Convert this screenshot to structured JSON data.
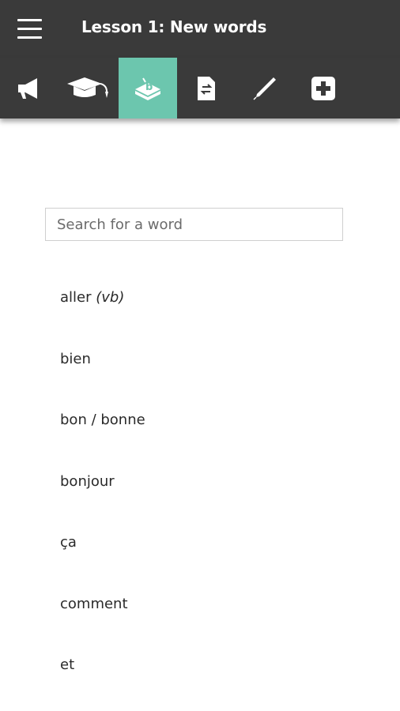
{
  "header": {
    "menu_icon": "hamburger-menu-icon",
    "title": "Lesson 1: New words"
  },
  "toolbar": {
    "accent_color": "#6cc6ae",
    "background_color": "#3a3a3a",
    "active_tab": "vocabulary",
    "tabs": [
      {
        "id": "audio",
        "icon": "megaphone-icon"
      },
      {
        "id": "learn",
        "icon": "graduation-cap-icon"
      },
      {
        "id": "vocabulary",
        "icon": "word-box-icon"
      },
      {
        "id": "translate",
        "icon": "document-swap-icon"
      },
      {
        "id": "write",
        "icon": "pen-icon"
      },
      {
        "id": "more",
        "icon": "plus-square-icon"
      }
    ]
  },
  "search": {
    "placeholder": "Search for a word",
    "value": ""
  },
  "words": [
    {
      "word": "aller",
      "pos": "(vb)"
    },
    {
      "word": "bien"
    },
    {
      "word": "bon / bonne"
    },
    {
      "word": "bonjour"
    },
    {
      "word": "ça"
    },
    {
      "word": "comment"
    },
    {
      "word": "et"
    }
  ]
}
